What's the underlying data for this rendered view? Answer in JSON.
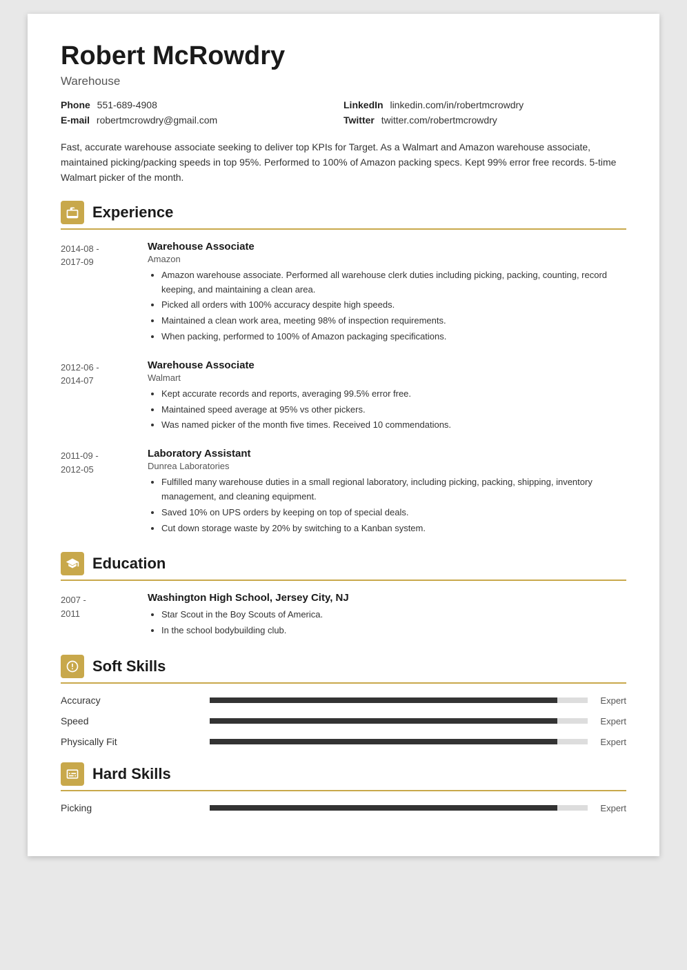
{
  "header": {
    "name": "Robert McRowdry",
    "title": "Warehouse"
  },
  "contact": {
    "phone_label": "Phone",
    "phone_value": "551-689-4908",
    "email_label": "E-mail",
    "email_value": "robertmcrowdry@gmail.com",
    "linkedin_label": "LinkedIn",
    "linkedin_value": "linkedin.com/in/robertmcrowdry",
    "twitter_label": "Twitter",
    "twitter_value": "twitter.com/robertmcrowdry"
  },
  "summary": "Fast, accurate warehouse associate seeking to deliver top KPIs for Target. As a Walmart and Amazon warehouse associate, maintained picking/packing speeds in top 95%. Performed to 100% of Amazon packing specs. Kept 99% error free records. 5-time Walmart picker of the month.",
  "sections": {
    "experience_label": "Experience",
    "education_label": "Education",
    "soft_skills_label": "Soft Skills",
    "hard_skills_label": "Hard Skills"
  },
  "experience": [
    {
      "date_start": "2014-08 -",
      "date_end": "2017-09",
      "title": "Warehouse Associate",
      "company": "Amazon",
      "bullets": [
        "Amazon warehouse associate. Performed all warehouse clerk duties including picking, packing, counting, record keeping, and maintaining a clean area.",
        "Picked all orders with 100% accuracy despite high speeds.",
        "Maintained a clean work area, meeting 98% of inspection requirements.",
        "When packing, performed to 100% of Amazon packaging specifications."
      ]
    },
    {
      "date_start": "2012-06 -",
      "date_end": "2014-07",
      "title": "Warehouse Associate",
      "company": "Walmart",
      "bullets": [
        "Kept accurate records and reports, averaging 99.5% error free.",
        "Maintained speed average at 95% vs other pickers.",
        "Was named picker of the month five times. Received 10 commendations."
      ]
    },
    {
      "date_start": "2011-09 -",
      "date_end": "2012-05",
      "title": "Laboratory Assistant",
      "company": "Dunrea Laboratories",
      "bullets": [
        "Fulfilled many warehouse duties in a small regional laboratory, including picking, packing, shipping, inventory management, and cleaning equipment.",
        "Saved 10% on UPS orders by keeping on top of special deals.",
        "Cut down storage waste by 20% by switching to a Kanban system."
      ]
    }
  ],
  "education": [
    {
      "date_start": "2007 -",
      "date_end": "2011",
      "school": "Washington High School, Jersey City, NJ",
      "bullets": [
        "Star Scout in the Boy Scouts of America.",
        "In the school bodybuilding club."
      ]
    }
  ],
  "soft_skills": [
    {
      "name": "Accuracy",
      "level": "Expert",
      "pct": 92
    },
    {
      "name": "Speed",
      "level": "Expert",
      "pct": 92
    },
    {
      "name": "Physically Fit",
      "level": "Expert",
      "pct": 92
    }
  ],
  "hard_skills": [
    {
      "name": "Picking",
      "level": "Expert",
      "pct": 92
    }
  ]
}
